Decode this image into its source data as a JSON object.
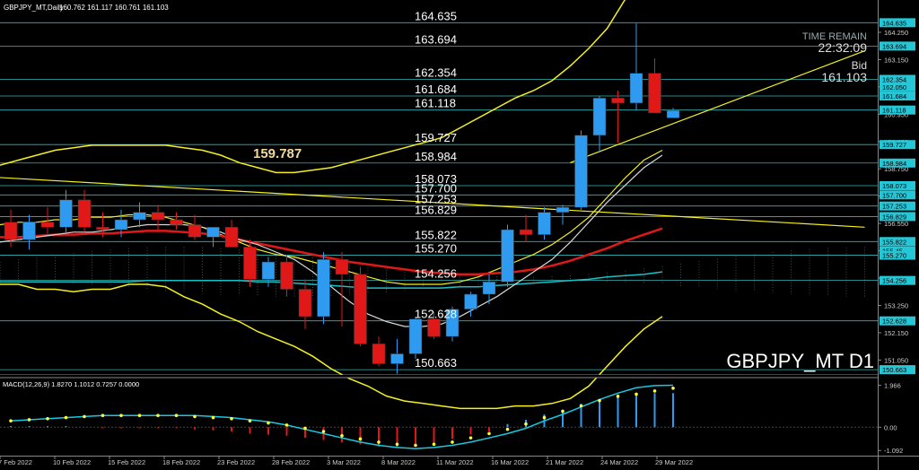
{
  "header": {
    "symbol_info": "GBPJPY_MT,Daily",
    "ohlc": "160.762 161.117 160.761 161.103"
  },
  "timer": {
    "label": "TIME REMAIN",
    "value": "22:32:09",
    "bid_label": "Bid",
    "bid_value": "161.103"
  },
  "watermark": "GBPJPY_MT D1",
  "highlight_level": "159.787",
  "colors": {
    "background": "#000000",
    "bull": "#2f9bf0",
    "bear": "#e01818",
    "level_line": "#3fd4d4",
    "bollinger": "#f5f01e",
    "ma_red": "#e01818",
    "ma_teal": "#18c0c8",
    "ma_white": "#d8d8d8",
    "macd_signal": "#18c8e0",
    "macd_dots": "#ffff40",
    "tag_bg": "#25c6d6"
  },
  "chart_data": {
    "type": "candlestick",
    "price_ylim": [
      150.45,
      165.55
    ],
    "price_ticks": [
      "164.250",
      "163.150",
      "162.050",
      "160.950",
      "159.850",
      "158.750",
      "157.650",
      "156.550",
      "155.450",
      "154.350",
      "153.250",
      "152.150",
      "151.050"
    ],
    "level_labels": [
      "164.635",
      "163.694",
      "162.354",
      "161.684",
      "161.118",
      "159.727",
      "158.984",
      "158.073",
      "157.700",
      "157.253",
      "156.829",
      "155.822",
      "155.270",
      "154.256",
      "152.628",
      "150.663"
    ],
    "level_tags": [
      "164.635",
      "163.694",
      "162.354",
      "162.050",
      "161.684",
      "161.118",
      "159.727",
      "158.984",
      "158.073",
      "157.700",
      "157.253",
      "156.829",
      "155.822",
      "155.45",
      "155.270",
      "154.256",
      "152.628",
      "150.663"
    ],
    "x_labels": [
      "7 Feb 2022",
      "10 Feb 2022",
      "15 Feb 2022",
      "18 Feb 2022",
      "23 Feb 2022",
      "28 Feb 2022",
      "3 Mar 2022",
      "8 Mar 2022",
      "11 Mar 2022",
      "16 Mar 2022",
      "21 Mar 2022",
      "24 Mar 2022",
      "29 Mar 2022"
    ],
    "candles": [
      {
        "o": 156.6,
        "h": 157.1,
        "l": 155.6,
        "c": 155.9
      },
      {
        "o": 155.9,
        "h": 156.9,
        "l": 155.5,
        "c": 156.6
      },
      {
        "o": 156.6,
        "h": 157.2,
        "l": 156.1,
        "c": 156.4
      },
      {
        "o": 156.4,
        "h": 157.9,
        "l": 156.2,
        "c": 157.5
      },
      {
        "o": 157.5,
        "h": 157.9,
        "l": 156.2,
        "c": 156.4
      },
      {
        "o": 156.4,
        "h": 157.0,
        "l": 156.0,
        "c": 156.3
      },
      {
        "o": 156.3,
        "h": 157.1,
        "l": 156.0,
        "c": 156.7
      },
      {
        "o": 156.7,
        "h": 157.4,
        "l": 156.4,
        "c": 157.0
      },
      {
        "o": 157.0,
        "h": 157.3,
        "l": 156.2,
        "c": 156.7
      },
      {
        "o": 156.7,
        "h": 157.0,
        "l": 156.3,
        "c": 156.5
      },
      {
        "o": 156.5,
        "h": 156.9,
        "l": 155.9,
        "c": 156.0
      },
      {
        "o": 156.0,
        "h": 156.4,
        "l": 155.6,
        "c": 156.4
      },
      {
        "o": 156.4,
        "h": 156.7,
        "l": 155.6,
        "c": 155.6
      },
      {
        "o": 155.6,
        "h": 155.9,
        "l": 154.0,
        "c": 154.3
      },
      {
        "o": 154.3,
        "h": 155.2,
        "l": 154.0,
        "c": 155.0
      },
      {
        "o": 155.0,
        "h": 155.3,
        "l": 153.6,
        "c": 153.9
      },
      {
        "o": 153.9,
        "h": 154.3,
        "l": 152.3,
        "c": 152.8
      },
      {
        "o": 152.8,
        "h": 155.4,
        "l": 152.5,
        "c": 155.1
      },
      {
        "o": 155.1,
        "h": 155.4,
        "l": 152.4,
        "c": 154.5
      },
      {
        "o": 154.5,
        "h": 154.8,
        "l": 151.6,
        "c": 151.7
      },
      {
        "o": 151.7,
        "h": 152.0,
        "l": 150.8,
        "c": 150.9
      },
      {
        "o": 150.9,
        "h": 151.9,
        "l": 150.5,
        "c": 151.3
      },
      {
        "o": 151.3,
        "h": 152.8,
        "l": 151.1,
        "c": 152.7
      },
      {
        "o": 152.7,
        "h": 153.0,
        "l": 151.9,
        "c": 152.0
      },
      {
        "o": 152.0,
        "h": 153.2,
        "l": 151.8,
        "c": 153.1
      },
      {
        "o": 153.1,
        "h": 153.8,
        "l": 152.8,
        "c": 153.7
      },
      {
        "o": 153.7,
        "h": 154.5,
        "l": 153.3,
        "c": 154.2
      },
      {
        "o": 154.2,
        "h": 156.5,
        "l": 154.0,
        "c": 156.3
      },
      {
        "o": 156.3,
        "h": 156.9,
        "l": 155.8,
        "c": 156.1
      },
      {
        "o": 156.1,
        "h": 157.2,
        "l": 155.9,
        "c": 157.0
      },
      {
        "o": 157.0,
        "h": 157.3,
        "l": 156.5,
        "c": 157.2
      },
      {
        "o": 157.2,
        "h": 160.3,
        "l": 157.1,
        "c": 160.1
      },
      {
        "o": 160.1,
        "h": 161.7,
        "l": 159.4,
        "c": 161.6
      },
      {
        "o": 161.6,
        "h": 161.9,
        "l": 159.8,
        "c": 161.4
      },
      {
        "o": 161.4,
        "h": 164.6,
        "l": 161.1,
        "c": 162.6
      },
      {
        "o": 162.6,
        "h": 163.2,
        "l": 161.0,
        "c": 161.0
      },
      {
        "o": 160.8,
        "h": 161.2,
        "l": 160.8,
        "c": 161.1
      }
    ],
    "bollinger_upper": [
      158.9,
      159.1,
      159.3,
      159.5,
      159.6,
      159.7,
      159.7,
      159.7,
      159.7,
      159.7,
      159.6,
      159.5,
      159.3,
      159.0,
      158.8,
      158.6,
      158.6,
      158.7,
      158.8,
      159.0,
      159.2,
      159.4,
      159.6,
      159.8,
      160.0,
      160.4,
      160.8,
      161.2,
      161.6,
      161.9,
      162.3,
      162.9,
      163.6,
      164.4,
      165.6,
      166.4,
      167.0
    ],
    "bollinger_middle": [
      156.5,
      156.6,
      156.6,
      156.7,
      156.7,
      156.8,
      156.8,
      156.9,
      156.9,
      156.8,
      156.6,
      156.4,
      156.1,
      155.8,
      155.5,
      155.3,
      155.2,
      155.0,
      154.8,
      154.6,
      154.4,
      154.2,
      154.1,
      154.1,
      154.1,
      154.2,
      154.4,
      154.7,
      155.0,
      155.3,
      155.7,
      156.2,
      156.8,
      157.6,
      158.4,
      159.1,
      159.5
    ],
    "bollinger_lower": [
      154.1,
      154.1,
      153.9,
      153.9,
      153.8,
      153.9,
      153.9,
      154.1,
      154.1,
      154.0,
      153.6,
      153.3,
      152.9,
      152.6,
      152.2,
      151.9,
      151.6,
      151.2,
      150.7,
      150.3,
      150.0,
      149.6,
      149.4,
      149.3,
      149.2,
      149.1,
      149.1,
      149.1,
      149.2,
      149.2,
      149.3,
      149.5,
      150.0,
      150.8,
      151.6,
      152.3,
      152.8
    ],
    "ma_red": [
      156.0,
      156.0,
      156.05,
      156.1,
      156.1,
      156.15,
      156.15,
      156.2,
      156.25,
      156.25,
      156.2,
      156.15,
      156.05,
      155.9,
      155.75,
      155.6,
      155.45,
      155.3,
      155.15,
      155.0,
      154.9,
      154.8,
      154.7,
      154.6,
      154.55,
      154.5,
      154.5,
      154.55,
      154.6,
      154.7,
      154.85,
      155.05,
      155.3,
      155.55,
      155.85,
      156.1,
      156.35
    ],
    "ma_teal": [
      154.2,
      154.2,
      154.2,
      154.2,
      154.2,
      154.2,
      154.2,
      154.2,
      154.25,
      154.25,
      154.25,
      154.25,
      154.25,
      154.25,
      154.2,
      154.2,
      154.15,
      154.1,
      154.05,
      154.0,
      153.95,
      153.95,
      153.95,
      153.95,
      153.95,
      154.0,
      154.0,
      154.05,
      154.1,
      154.15,
      154.2,
      154.25,
      154.3,
      154.4,
      154.45,
      154.5,
      154.6
    ],
    "ma_white": [
      155.8,
      155.9,
      156.0,
      156.1,
      156.2,
      156.2,
      156.3,
      156.4,
      156.5,
      156.5,
      156.5,
      156.4,
      156.2,
      155.9,
      155.7,
      155.4,
      155.1,
      154.6,
      154.0,
      153.4,
      152.9,
      152.6,
      152.4,
      152.4,
      152.5,
      152.8,
      153.2,
      153.6,
      154.1,
      154.6,
      155.1,
      155.8,
      156.6,
      157.4,
      158.1,
      158.8,
      159.3
    ],
    "trendlines": [
      {
        "p1": [
          0,
          158.4
        ],
        "p2": [
          47,
          156.4
        ]
      },
      {
        "p1": [
          31,
          159.0
        ],
        "p2": [
          47,
          163.5
        ]
      }
    ],
    "macd": {
      "label": "MACD(12,26,9) 1.8270 1.1012 0.7257 0.0000",
      "ylim": [
        -1.25,
        2.2
      ],
      "ticks": [
        "1.966",
        "0.00",
        "-1.092"
      ],
      "histogram": [
        0.05,
        0.05,
        0.05,
        0.05,
        0.0,
        -0.05,
        -0.05,
        -0.05,
        -0.05,
        -0.05,
        -0.1,
        -0.15,
        -0.2,
        -0.3,
        -0.35,
        -0.4,
        -0.5,
        -0.6,
        -0.7,
        -0.8,
        -0.9,
        -0.95,
        -0.9,
        -0.75,
        -0.55,
        -0.35,
        -0.2,
        0.15,
        0.35,
        0.6,
        0.8,
        1.1,
        1.3,
        1.5,
        1.6,
        1.6,
        1.6
      ],
      "signal": [
        0.3,
        0.35,
        0.4,
        0.45,
        0.5,
        0.55,
        0.55,
        0.55,
        0.55,
        0.55,
        0.55,
        0.5,
        0.45,
        0.35,
        0.25,
        0.1,
        -0.1,
        -0.3,
        -0.5,
        -0.7,
        -0.85,
        -0.95,
        -1.0,
        -0.95,
        -0.85,
        -0.7,
        -0.5,
        -0.3,
        -0.05,
        0.3,
        0.6,
        0.95,
        1.3,
        1.6,
        1.85,
        1.95,
        1.97
      ],
      "dots": [
        0.3,
        0.35,
        0.4,
        0.45,
        0.5,
        0.55,
        0.55,
        0.55,
        0.55,
        0.55,
        0.5,
        0.45,
        0.4,
        0.3,
        0.2,
        0.1,
        -0.05,
        -0.2,
        -0.4,
        -0.55,
        -0.7,
        -0.8,
        -0.85,
        -0.8,
        -0.7,
        -0.5,
        -0.3,
        -0.1,
        0.15,
        0.45,
        0.75,
        1.0,
        1.25,
        1.45,
        1.55,
        1.7,
        1.83
      ]
    }
  }
}
